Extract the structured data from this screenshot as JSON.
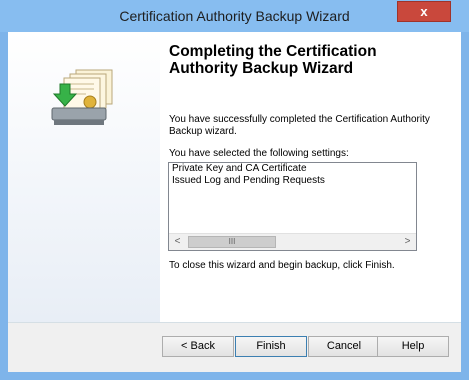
{
  "window": {
    "title": "Certification Authority Backup Wizard",
    "close_glyph": "x"
  },
  "page": {
    "heading": "Completing the Certification Authority Backup Wizard",
    "message": "You have successfully completed the Certification Authority Backup wizard.",
    "settings_label": "You have selected the following settings:",
    "settings": [
      "Private Key and CA Certificate",
      "Issued Log and Pending Requests"
    ],
    "finish_hint": "To close this wizard and begin backup, click Finish."
  },
  "scrollbar": {
    "left_arrow": "<",
    "right_arrow": ">",
    "thumb_grip": "III"
  },
  "buttons": {
    "back": "< Back",
    "finish": "Finish",
    "cancel": "Cancel",
    "help": "Help"
  }
}
